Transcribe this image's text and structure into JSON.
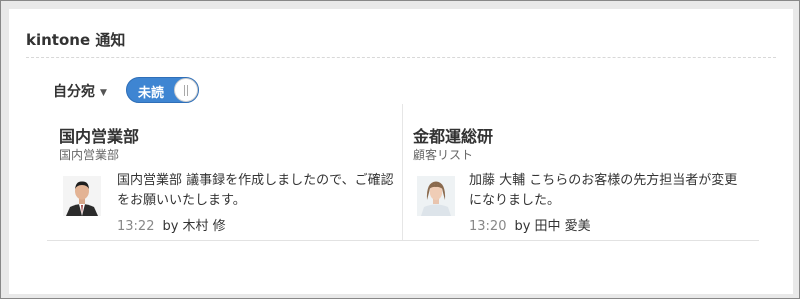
{
  "widget": {
    "title": "kintone 通知"
  },
  "filter": {
    "label": "自分宛",
    "toggle_label": "未読"
  },
  "notifications": [
    {
      "title": "国内営業部",
      "subtitle": "国内営業部",
      "message": "国内営業部 議事録を作成しましたので、ご確認をお願いいたします。",
      "time": "13:22",
      "by": "by 木村 修",
      "avatar": "man-in-suit-avatar"
    },
    {
      "title": "金都運総研",
      "subtitle": "顧客リスト",
      "message": "加藤 大輔 こちらのお客様の先方担当者が変更になりました。",
      "time": "13:20",
      "by": "by 田中 愛美",
      "avatar": "woman-avatar"
    }
  ],
  "colors": {
    "toggle_bg": "#3e85d2",
    "background": "#e9e9e9"
  }
}
